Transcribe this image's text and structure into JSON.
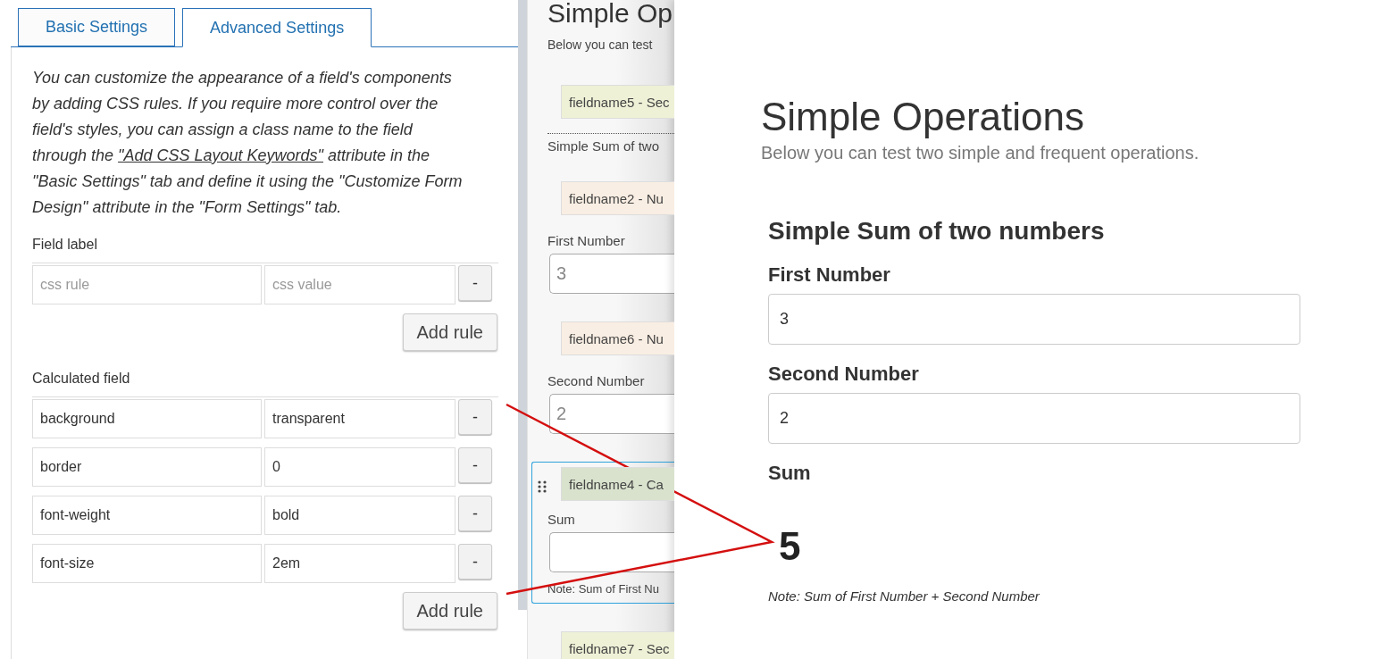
{
  "tabs": [
    {
      "label": "Basic Settings",
      "selected": false
    },
    {
      "label": "Advanced Settings",
      "selected": true
    }
  ],
  "description": {
    "before": "You can customize the appearance of a field's components by adding CSS rules. If you require more control over the field's styles, you can assign a class name to the field through the ",
    "link": "\"Add CSS Layout Keywords\"",
    "after": " attribute in the \"Basic Settings\" tab and define it using the \"Customize Form Design\" attribute in the \"Form Settings\" tab."
  },
  "sections": [
    {
      "label": "Field label",
      "rules": [
        {
          "rule": {
            "placeholder": "css rule"
          },
          "value": {
            "placeholder": "css value"
          },
          "remove": "-"
        }
      ],
      "add_button": "Add rule"
    },
    {
      "label": "Calculated field",
      "rules": [
        {
          "rule": {
            "value": "background"
          },
          "value": {
            "value": "transparent"
          },
          "remove": "-"
        },
        {
          "rule": {
            "value": "border"
          },
          "value": {
            "value": "0"
          },
          "remove": "-"
        },
        {
          "rule": {
            "value": "font-weight"
          },
          "value": {
            "value": "bold"
          },
          "remove": "-"
        },
        {
          "rule": {
            "value": "font-size"
          },
          "value": {
            "value": "2em"
          },
          "remove": "-"
        }
      ],
      "add_button": "Add rule"
    }
  ],
  "builder": {
    "title": "Simple Op",
    "subtitle": "Below you can test",
    "fields": [
      {
        "kind": "section",
        "tag": "fieldname5 - Sec",
        "color": "#eef1d6",
        "selected": false,
        "title": "Simple Sum of two"
      },
      {
        "kind": "number",
        "tag": "fieldname2 - Nu",
        "color": "#f9eee3",
        "selected": false,
        "label": "First Number",
        "value": "3"
      },
      {
        "kind": "number",
        "tag": "fieldname6 - Nu",
        "color": "#f9eee3",
        "selected": false,
        "label": "Second Number",
        "value": "2"
      },
      {
        "kind": "calculated",
        "tag": "fieldname4 - Ca",
        "color": "#d9e2cd",
        "selected": true,
        "label": "Sum",
        "note": "Note: Sum of First Nu"
      },
      {
        "kind": "section",
        "tag": "fieldname7 - Sec",
        "color": "#eef1d6",
        "selected": false
      }
    ]
  },
  "preview": {
    "title": "Simple Operations",
    "subtitle": "Below you can test two simple and frequent operations.",
    "section": "Simple Sum of two numbers",
    "fields": [
      {
        "kind": "input",
        "label": "First Number",
        "value": "3"
      },
      {
        "kind": "input",
        "label": "Second Number",
        "value": "2"
      },
      {
        "kind": "result",
        "label": "Sum",
        "value": "5",
        "note": "Note: Sum of First Number + Second Number"
      }
    ]
  }
}
